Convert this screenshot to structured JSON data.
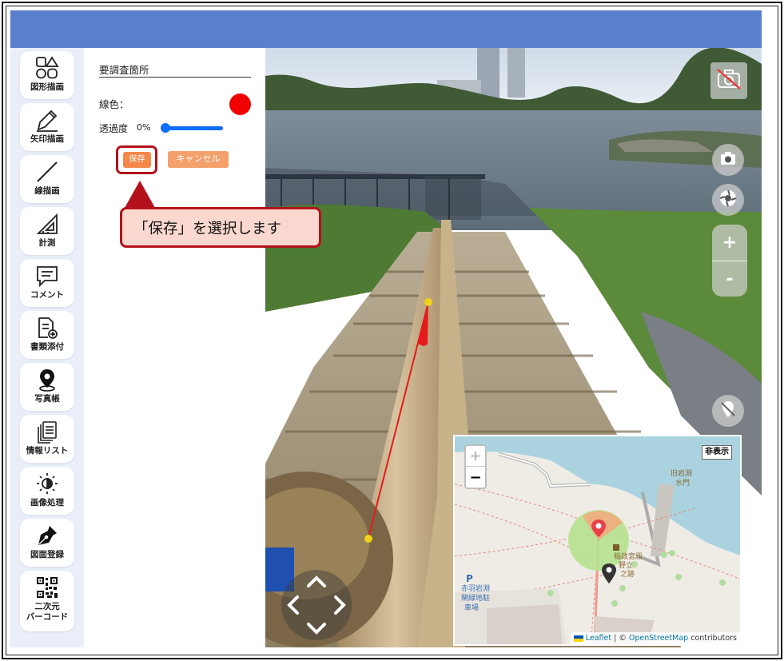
{
  "sidebar": {
    "tools": [
      {
        "label": "図形描画",
        "icon": "shapes-icon"
      },
      {
        "label": "矢印描画",
        "icon": "arrow-draw-icon"
      },
      {
        "label": "線描画",
        "icon": "line-draw-icon"
      },
      {
        "label": "計測",
        "icon": "ruler-triangle-icon"
      },
      {
        "label": "コメント",
        "icon": "comment-icon"
      },
      {
        "label": "書類添付",
        "icon": "document-attach-icon"
      },
      {
        "label": "写真帳",
        "icon": "map-pin-icon"
      },
      {
        "label": "情報リスト",
        "icon": "info-list-icon"
      },
      {
        "label": "画像処理",
        "icon": "brightness-icon"
      },
      {
        "label": "図面登録",
        "icon": "pen-nib-icon"
      },
      {
        "label": "二次元",
        "label2": "バーコード",
        "icon": "qr-code-icon"
      }
    ]
  },
  "panel": {
    "title": "要調査箇所",
    "line_color_label": "線色：",
    "line_color": "#f00000",
    "opacity_label": "透過度",
    "opacity_value_text": "0%",
    "opacity_fraction": 0,
    "save_label": "保存",
    "cancel_label": "キャンセル"
  },
  "callout": {
    "text": "「保存」を選択します"
  },
  "viewer": {
    "zoom_in": "+",
    "zoom_out": "-"
  },
  "minimap": {
    "zoom_in": "+",
    "zoom_out": "−",
    "hide_label": "非表示",
    "attribution": {
      "leaflet": "Leaflet",
      "separator": "| ©",
      "osm": "OpenStreetMap",
      "suffix": "contributors"
    },
    "place_labels": {
      "old_iwabuchi_line1": "旧岩淵",
      "old_iwabuchi_line2": "水門",
      "shrine_line1": "稲政宮殿",
      "shrine_line2": "野立",
      "shrine_line3": "之跡",
      "parking_p": "P",
      "parking_line1": "赤羽岩淵",
      "parking_line2": "閘緑地駐",
      "parking_line3": "車場"
    }
  },
  "colors": {
    "header": "#5a7fcc",
    "accent_button": "#f4884b",
    "highlight": "#b3121c"
  }
}
